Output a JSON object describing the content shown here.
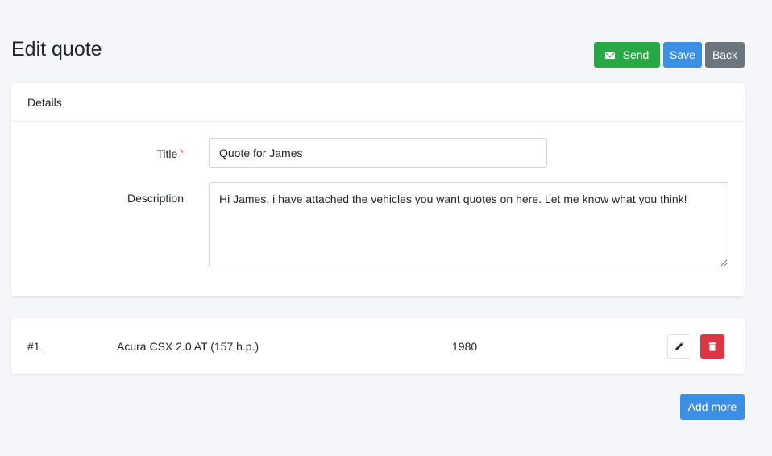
{
  "page": {
    "title": "Edit quote"
  },
  "actions": {
    "send_label": "Send",
    "save_label": "Save",
    "back_label": "Back"
  },
  "details": {
    "header": "Details",
    "title_label": "Title",
    "required_mark": "*",
    "title_value": "Quote for James",
    "description_label": "Description",
    "description_value": "Hi James, i have attached the vehicles you want quotes on here. Let me know what you think!"
  },
  "items": [
    {
      "number": "#1",
      "name": "Acura CSX 2.0 AT (157 h.p.)",
      "year": "1980"
    }
  ],
  "add_more_label": "Add more",
  "colors": {
    "send": "#28a745",
    "primary": "#3b8fe5",
    "secondary": "#6c757d",
    "danger": "#dc3545",
    "background": "#f4f6f9"
  },
  "icons": {
    "send": "envelope-icon",
    "edit": "pencil-icon",
    "delete": "trash-icon"
  }
}
